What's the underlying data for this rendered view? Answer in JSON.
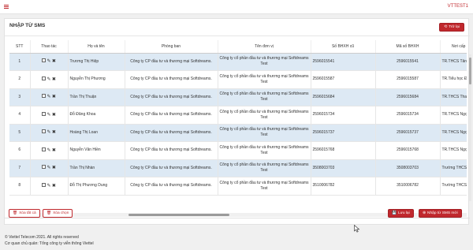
{
  "header": {
    "user": "VTTEST1"
  },
  "page": {
    "title": "NHẬP TỪ SMS",
    "back_label": "Trở lại"
  },
  "table": {
    "columns": [
      "STT",
      "Thao tác",
      "Họ và tên",
      "Phòng ban",
      "Tên đơn vị",
      "Số BHXH cũ",
      "Mã số BHXH",
      "Nơi cấp sổ"
    ],
    "rows": [
      {
        "stt": "1",
        "name": "Trương Thị Hiệp",
        "dept": "Công ty CP đầu tư và thương mại Softdreams.",
        "unit": "Công ty cổ phần đầu tư và thương mại Softdreams Test",
        "old": "2596015541",
        "code": "2596015541",
        "place": "TR.THCS Tân T"
      },
      {
        "stt": "2",
        "name": "Nguyễn Thị Phương",
        "dept": "Công ty CP đầu tư và thương mại Softdreams.",
        "unit": "Công ty cổ phần đầu tư và thương mại Softdreams Test",
        "old": "2596015587",
        "code": "2596015587",
        "place": "TR.Tiểu học Đ"
      },
      {
        "stt": "3",
        "name": "Trần Thị Thuận",
        "dept": "Công ty CP đầu tư và thương mại Softdreams.",
        "unit": "Công ty cổ phần đầu tư và thương mại Softdreams Test",
        "old": "2596015684",
        "code": "2596015684",
        "place": "TR.THCS Than"
      },
      {
        "stt": "4",
        "name": "Đỗ Đăng Khoa",
        "dept": "Công ty CP đầu tư và thương mại Softdreams.",
        "unit": "Công ty cổ phần đầu tư và thương mại Softdreams Test",
        "old": "2596015734",
        "code": "2596015734",
        "place": "TR.THCS Ngọc"
      },
      {
        "stt": "5",
        "name": "Hoàng Thị Loan",
        "dept": "Công ty CP đầu tư và thương mại Softdreams.",
        "unit": "Công ty cổ phần đầu tư và thương mại Softdreams Test",
        "old": "2596015737",
        "code": "2596015737",
        "place": "TR.THCS Ngọc"
      },
      {
        "stt": "6",
        "name": "Nguyễn Văn Hiền",
        "dept": "Công ty CP đầu tư và thương mại Softdreams.",
        "unit": "Công ty cổ phần đầu tư và thương mại Softdreams Test",
        "old": "2596015768",
        "code": "2596015768",
        "place": "TR.THCS Ngọc"
      },
      {
        "stt": "7",
        "name": "Trần Thị Nhàn",
        "dept": "Công ty CP đầu tư và thương mại Softdreams.",
        "unit": "Công ty cổ phần đầu tư và thương mại Softdreams Test",
        "old": "3508003703",
        "code": "3508003703",
        "place": "Trường THCS"
      },
      {
        "stt": "8",
        "name": "Đỗ Thị Phương Dung",
        "dept": "Công ty CP đầu tư và thương mại Softdreams.",
        "unit": "Công ty cổ phần đầu tư và thương mại Softdreams Test",
        "old": "3510006782",
        "code": "3510006782",
        "place": "Trường THCS"
      }
    ]
  },
  "actions": {
    "delete_all": "Xóa tất cả",
    "delete_selected": "Xóa chọn",
    "save": "Lưu lại",
    "import_new": "Nhập từ SMS mới"
  },
  "footer": {
    "copyright": "© Viettel Telecom 2021. All rights reserved",
    "agency": "Cơ quan chủ quản: Tổng công ty viễn thông Viettel"
  },
  "colors": {
    "brand": "#c0282d",
    "row_alt": "#dde9f4"
  }
}
